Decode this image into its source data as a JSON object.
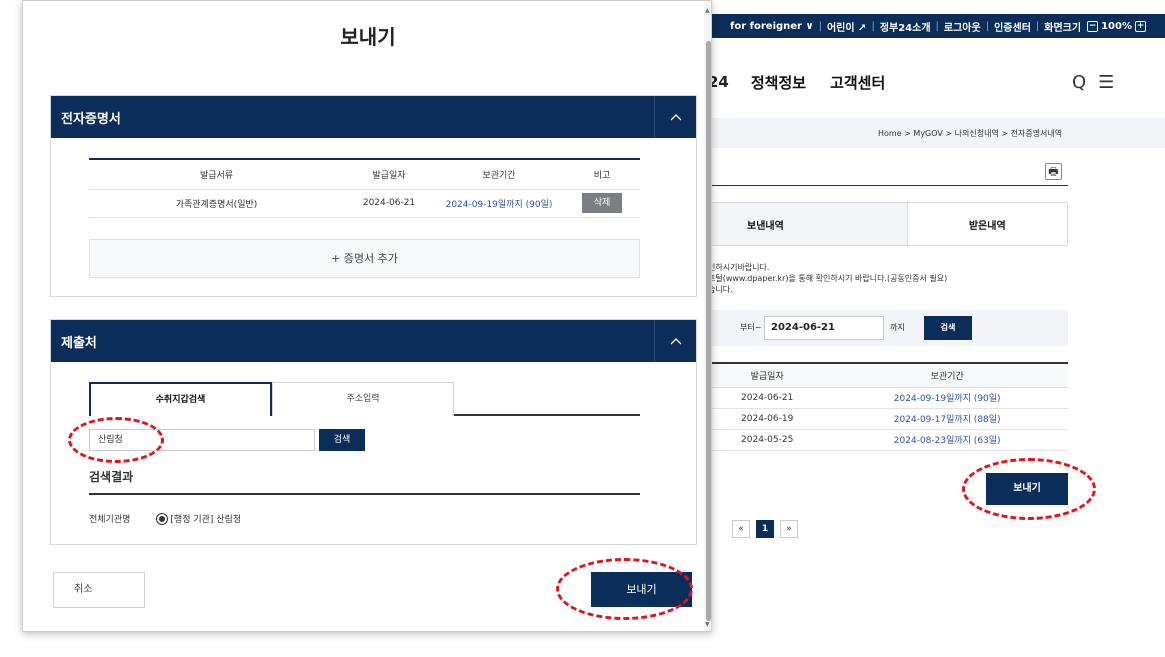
{
  "background": {
    "topbar": {
      "items": [
        "for foreigner ∨",
        "어린이 ↗",
        "정부24소개",
        "로그아웃",
        "인증센터",
        "화면크기"
      ],
      "zoom_minus": "−",
      "zoom_value": "100%",
      "zoom_plus": "+"
    },
    "gnb": {
      "cut_item": "24",
      "items": [
        "정책정보",
        "고객센터"
      ],
      "search_icon": "Q",
      "menu_icon": "☰"
    },
    "breadcrumb": "Home > MyGOV > 나의신청내역 > 전자증명서내역",
    "print_icon": "🖶",
    "tabs": [
      "보낸내역",
      "받은내역"
    ],
    "notice": [
      "인하시기바랍니다.",
      "포털(www.dpaper.kr)을 통해 확인하시기 바랍니다.(공동인증서 필요)",
      "습니다."
    ],
    "search": {
      "from_label": "부터~",
      "to_date": "2024-06-21",
      "to_label": "까지",
      "button": "검색"
    },
    "table": {
      "headers": [
        "발급일자",
        "보관기간"
      ],
      "rows": [
        [
          "2024-06-21",
          "2024-09-19일까지 (90일)"
        ],
        [
          "2024-06-19",
          "2024-09-17일까지 (88일)"
        ],
        [
          "2024-05-25",
          "2024-08-23일까지 (63일)"
        ]
      ]
    },
    "send_button": "보내기",
    "pager": [
      "«",
      "1",
      "»"
    ]
  },
  "modal": {
    "title": "보내기",
    "cert_section": {
      "title": "전자증명서",
      "headers": [
        "발급서류",
        "발급일자",
        "보관기간",
        "비고"
      ],
      "rows": [
        [
          "가족관계증명서(일반)",
          "2024-06-21",
          "2024-09-19일까지 (90일)",
          "삭제"
        ]
      ],
      "add_label": "+ 증명서 추가"
    },
    "submit_section": {
      "title": "제출처",
      "tabs": [
        "수취지갑검색",
        "주소입력"
      ],
      "org_input_value": "산림청",
      "search_button": "검색",
      "result_title": "검색결과",
      "result_label": "전체기관명",
      "result_value": "[행정 기관] 산림청"
    },
    "cancel_button": "취소",
    "send_button": "보내기"
  },
  "colors": {
    "navy": "#0b2d59",
    "link_blue": "#2b53a8",
    "highlight_red": "#e0141c"
  }
}
